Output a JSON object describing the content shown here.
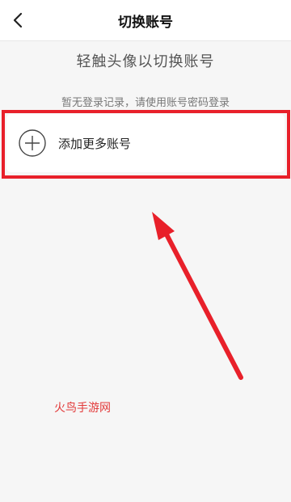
{
  "header": {
    "back_icon": "chevron-left-icon",
    "title": "切换账号"
  },
  "main": {
    "instruction": "轻触头像以切换账号",
    "empty_notice": "暂无登录记录，请使用账号密码登录",
    "add_account": {
      "icon": "plus-circle-icon",
      "label": "添加更多账号"
    }
  },
  "annotation": {
    "highlight_color": "#e8202a",
    "arrow_color": "#e8202a"
  },
  "watermark": {
    "text": "火鸟手游网"
  }
}
